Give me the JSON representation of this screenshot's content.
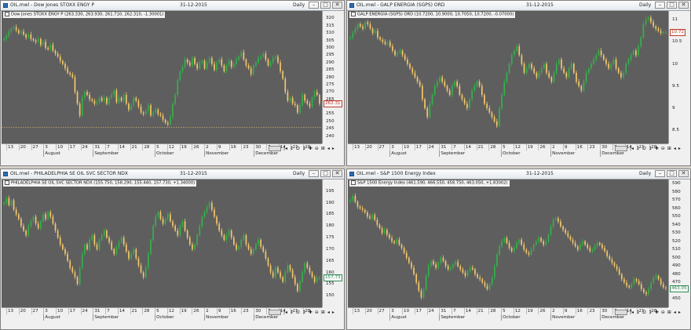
{
  "windows": [
    {
      "id": "tl",
      "title": "OIL.mwl - Dow Jones STOXX ENGY P",
      "date": "31-12-2015",
      "period": "Daily",
      "info": "Dow Jones STOXX ENGY P (263.330, 263.930, 261.710, 262.310, -1.30001)",
      "current_value": "262.31",
      "current_color": "#c0392b",
      "months": [
        "August",
        "September",
        "October",
        "November",
        "December"
      ],
      "days": [
        "13",
        "20",
        "27",
        "3",
        "10",
        "17",
        "24",
        "31",
        "7",
        "14",
        "21",
        "28",
        "5",
        "12",
        "19",
        "26",
        "2",
        "9",
        "16",
        "23",
        "30",
        "7",
        "14",
        "21",
        "28"
      ],
      "chart_data": {
        "type": "candlestick",
        "ylim": [
          235,
          325
        ],
        "yticks": [
          240,
          245,
          250,
          255,
          260,
          265,
          270,
          275,
          280,
          285,
          290,
          295,
          300,
          305,
          310,
          315,
          320
        ],
        "ref_line": 246,
        "closes": [
          306,
          308,
          311,
          313,
          314,
          312,
          310,
          311,
          309,
          307,
          309,
          306,
          305,
          304,
          306,
          302,
          304,
          300,
          299,
          302,
          298,
          296,
          294,
          291,
          289,
          286,
          283,
          282,
          280,
          270,
          262,
          254,
          266,
          270,
          268,
          265,
          264,
          262,
          263,
          266,
          264,
          266,
          262,
          266,
          268,
          271,
          263,
          266,
          264,
          268,
          262,
          258,
          261,
          266,
          264,
          260,
          256,
          255,
          257,
          261,
          254,
          256,
          258,
          255,
          254,
          251,
          249,
          248,
          253,
          262,
          268,
          278,
          284,
          287,
          292,
          290,
          288,
          293,
          289,
          286,
          290,
          291,
          286,
          290,
          293,
          289,
          285,
          290,
          292,
          288,
          284,
          288,
          291,
          287,
          289,
          292,
          294,
          297,
          292,
          288,
          286,
          282,
          288,
          290,
          293,
          294,
          296,
          292,
          288,
          290,
          293,
          294,
          290,
          284,
          279,
          270,
          264,
          266,
          262,
          261,
          256,
          261,
          268,
          264,
          262,
          260,
          266,
          270,
          268,
          262
        ]
      }
    },
    {
      "id": "tr",
      "title": "OIL.mwl - GALP ENERGIA (SGPS) ORD",
      "date": "31-12-2015",
      "period": "Daily",
      "info": "GALP ENERGIA (SGPS) ORD (10.7200, 10.9000, 10.7050, 10.7200, -0.07000)",
      "current_value": "10.72",
      "current_color": "#c0392b",
      "months": [
        "August",
        "September",
        "October",
        "November",
        "December"
      ],
      "days": [
        "13",
        "20",
        "27",
        "3",
        "10",
        "17",
        "24",
        "31",
        "7",
        "14",
        "21",
        "28",
        "5",
        "12",
        "19",
        "26",
        "2",
        "9",
        "16",
        "23",
        "30",
        "7",
        "14",
        "21",
        "28"
      ],
      "chart_data": {
        "type": "candlestick",
        "ylim": [
          8.2,
          11.2
        ],
        "yticks": [
          8.5,
          9.0,
          9.5,
          10.0,
          10.5,
          11.0
        ],
        "closes": [
          10.6,
          10.7,
          10.8,
          10.9,
          10.85,
          10.8,
          10.95,
          10.9,
          10.8,
          10.7,
          10.75,
          10.6,
          10.55,
          10.5,
          10.45,
          10.5,
          10.4,
          10.3,
          10.2,
          10.25,
          10.3,
          10.2,
          10.1,
          10.0,
          9.9,
          9.8,
          9.7,
          9.6,
          9.5,
          9.2,
          9.0,
          8.8,
          9.1,
          9.3,
          9.5,
          9.6,
          9.7,
          9.6,
          9.5,
          9.4,
          9.3,
          9.5,
          9.6,
          9.5,
          9.3,
          9.2,
          9.1,
          9.0,
          9.2,
          9.4,
          9.5,
          9.6,
          9.5,
          9.3,
          9.1,
          9.0,
          8.9,
          8.8,
          8.7,
          8.6,
          9.0,
          9.3,
          9.6,
          9.8,
          10.0,
          10.2,
          10.3,
          10.4,
          10.2,
          10.0,
          9.8,
          9.9,
          10.0,
          9.9,
          9.8,
          9.7,
          9.8,
          9.9,
          10.0,
          9.8,
          9.7,
          9.6,
          9.8,
          10.0,
          10.1,
          9.9,
          9.8,
          9.7,
          9.9,
          10.0,
          9.8,
          9.6,
          9.5,
          9.4,
          9.6,
          9.8,
          9.9,
          10.0,
          10.1,
          10.2,
          10.3,
          10.2,
          10.1,
          10.0,
          9.9,
          10.0,
          10.1,
          9.9,
          9.8,
          9.7,
          9.8,
          10.0,
          10.1,
          10.2,
          10.3,
          10.2,
          10.4,
          10.6,
          10.9,
          11.0,
          11.05,
          10.95,
          10.85,
          10.8,
          10.75,
          10.7,
          10.72,
          10.72
        ]
      }
    },
    {
      "id": "bl",
      "title": "OIL.mwl - PHILADELPHIA SE OIL SVC SECTOR NDX",
      "date": "31-12-2015",
      "period": "Daily",
      "info": "PHILADELPHIA SE OIL SVC SECTOR NDX (155.750, 158.290, 155.440, 157.730, +1.34000)",
      "current_value": "157.73",
      "current_color": "#2e8b57",
      "months": [
        "August",
        "September",
        "October",
        "November",
        "December"
      ],
      "days": [
        "13",
        "20",
        "27",
        "3",
        "10",
        "17",
        "24",
        "31",
        "7",
        "14",
        "21",
        "28",
        "5",
        "12",
        "19",
        "26",
        "2",
        "9",
        "16",
        "23",
        "30",
        "7",
        "14",
        "21",
        "28"
      ],
      "chart_data": {
        "type": "candlestick",
        "ylim": [
          145,
          200
        ],
        "yticks": [
          150,
          155,
          160,
          165,
          170,
          175,
          180,
          185,
          190,
          195
        ],
        "closes": [
          190,
          192,
          189,
          191,
          187,
          185,
          183,
          180,
          178,
          176,
          180,
          182,
          184,
          181,
          179,
          182,
          185,
          183,
          186,
          184,
          181,
          178,
          175,
          172,
          170,
          168,
          165,
          162,
          160,
          158,
          155,
          162,
          168,
          172,
          170,
          174,
          176,
          172,
          170,
          174,
          176,
          178,
          175,
          173,
          170,
          168,
          171,
          173,
          175,
          172,
          169,
          166,
          168,
          170,
          166,
          163,
          160,
          158,
          162,
          168,
          174,
          180,
          184,
          186,
          183,
          181,
          183,
          185,
          182,
          180,
          178,
          176,
          180,
          182,
          178,
          175,
          172,
          170,
          172,
          176,
          180,
          184,
          186,
          188,
          190,
          187,
          184,
          181,
          178,
          176,
          174,
          176,
          178,
          175,
          172,
          170,
          171,
          174,
          176,
          172,
          170,
          168,
          170,
          172,
          174,
          171,
          169,
          166,
          163,
          160,
          158,
          162,
          160,
          158,
          156,
          160,
          163,
          161,
          158,
          155,
          152,
          156,
          160,
          164,
          162,
          160,
          158,
          156,
          157.7,
          157.7
        ]
      }
    },
    {
      "id": "br",
      "title": "OIL.mwl - S&P 1500 Energy Index",
      "date": "31-12-2015",
      "period": "Daily",
      "info": "S&P 1500 Energy Index (461.590, 466.550, 458.750, 463.050, +1.83002)",
      "current_value": "463.05",
      "current_color": "#2e8b57",
      "months": [
        "August",
        "September",
        "October",
        "November",
        "December"
      ],
      "days": [
        "13",
        "20",
        "27",
        "3",
        "10",
        "17",
        "24",
        "31",
        "7",
        "14",
        "21",
        "28",
        "5",
        "12",
        "19",
        "26",
        "2",
        "9",
        "16",
        "23",
        "30",
        "7",
        "14",
        "21",
        "28"
      ],
      "chart_data": {
        "type": "candlestick",
        "ylim": [
          440,
          595
        ],
        "yticks": [
          450,
          460,
          470,
          480,
          490,
          500,
          510,
          520,
          530,
          540,
          550,
          560,
          570,
          580,
          590
        ],
        "closes": [
          570,
          575,
          568,
          562,
          560,
          558,
          555,
          550,
          548,
          552,
          546,
          540,
          536,
          530,
          534,
          528,
          524,
          520,
          518,
          522,
          516,
          512,
          506,
          500,
          494,
          488,
          480,
          470,
          460,
          452,
          462,
          478,
          490,
          496,
          492,
          488,
          494,
          500,
          496,
          490,
          486,
          488,
          492,
          495,
          490,
          486,
          482,
          478,
          484,
          488,
          486,
          480,
          476,
          474,
          470,
          466,
          462,
          468,
          476,
          490,
          504,
          514,
          520,
          524,
          518,
          512,
          508,
          512,
          518,
          522,
          516,
          510,
          506,
          504,
          510,
          516,
          520,
          524,
          520,
          516,
          520,
          528,
          538,
          546,
          548,
          544,
          538,
          534,
          530,
          526,
          522,
          518,
          514,
          510,
          516,
          520,
          516,
          512,
          508,
          510,
          514,
          518,
          516,
          512,
          508,
          502,
          498,
          494,
          490,
          486,
          480,
          474,
          470,
          466,
          464,
          468,
          474,
          472,
          468,
          462,
          458,
          456,
          462,
          470,
          476,
          478,
          474,
          468,
          464,
          463.05
        ]
      }
    }
  ]
}
